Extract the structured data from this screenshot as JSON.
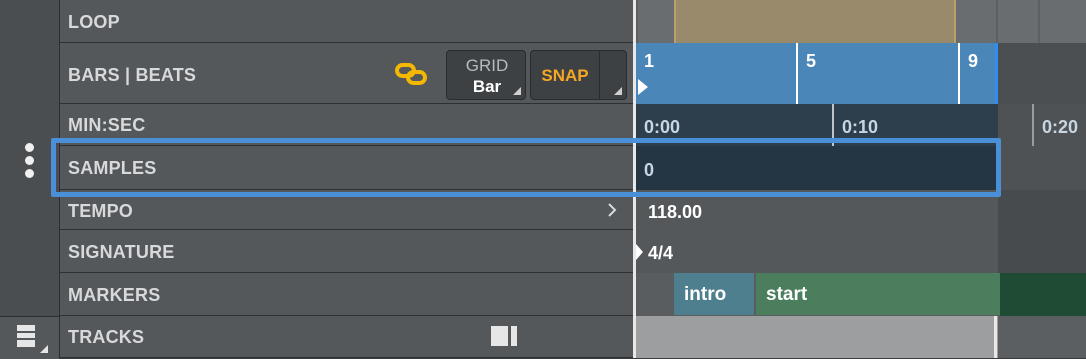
{
  "rows": {
    "loop": "LOOP",
    "bars_beats": "BARS | BEATS",
    "min_sec": "MIN:SEC",
    "samples": "SAMPLES",
    "tempo": "TEMPO",
    "signature": "SIGNATURE",
    "markers": "MARKERS",
    "tracks": "TRACKS"
  },
  "controls": {
    "grid_label": "GRID",
    "grid_value": "Bar",
    "snap_label": "SNAP",
    "link_icon": "chain-link-icon",
    "tempo_arrow_icon": "chevron-right-icon",
    "menu_icon": "vertical-dots-icon",
    "tracks_icon": "track-list-icon",
    "tracks_toggle_icon": "split-view-icon"
  },
  "timeline": {
    "bars": [
      "1",
      "5",
      "9"
    ],
    "min_sec": [
      "0:00",
      "0:10",
      "0:20"
    ],
    "samples": "0",
    "tempo": "118.00",
    "signature": "4/4",
    "markers": [
      {
        "label": "intro"
      },
      {
        "label": "start"
      }
    ]
  },
  "colors": {
    "snap_text": "#f5a623",
    "link_icon": "#f5b800",
    "highlight": "#4a90d9",
    "bars_fill": "#4a86b8",
    "marker_intro": "#4e7f8f",
    "marker_start": "#3d7a56"
  }
}
